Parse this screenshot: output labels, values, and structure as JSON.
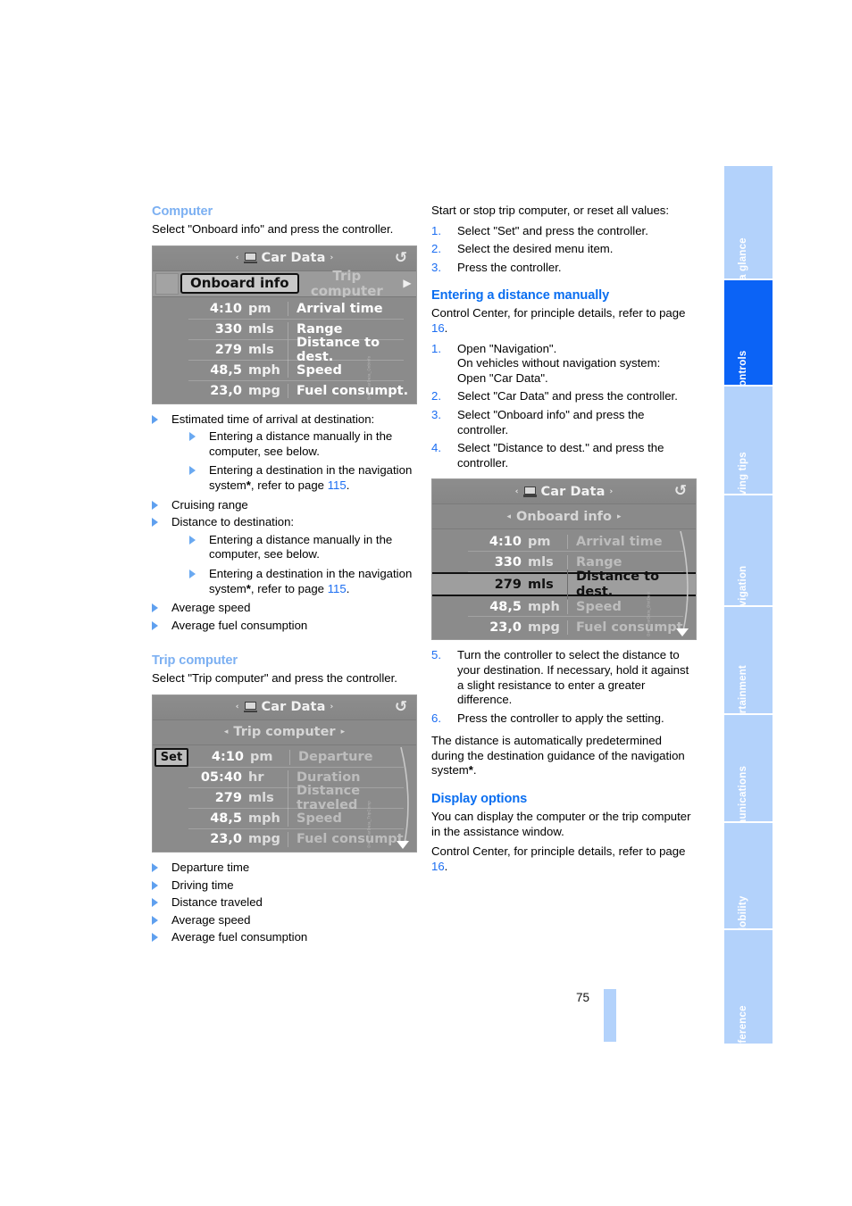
{
  "page": {
    "number": "75"
  },
  "sidebar": {
    "tabs": [
      {
        "label": "At a glance",
        "active": false
      },
      {
        "label": "Controls",
        "active": true
      },
      {
        "label": "Driving tips",
        "active": false
      },
      {
        "label": "Navigation",
        "active": false
      },
      {
        "label": "Entertainment",
        "active": false
      },
      {
        "label": "Communications",
        "active": false
      },
      {
        "label": "Mobility",
        "active": false
      },
      {
        "label": "Reference",
        "active": false
      }
    ]
  },
  "left_column": {
    "computer": {
      "heading": "Computer",
      "intro": "Select \"Onboard info\" and press the controller.",
      "screenshot": {
        "title": "Car Data",
        "left_arrow": "‹",
        "right_arrow": "›",
        "tab_selected": "Onboard info",
        "tab_unselected": "Trip computer",
        "tab_next_arrow": "▶",
        "rows": [
          {
            "value": "4:10",
            "unit": "pm",
            "label": "Arrival time"
          },
          {
            "value": "330",
            "unit": "mls",
            "label": "Range"
          },
          {
            "value": "279",
            "unit": "mls",
            "label": "Distance to dest."
          },
          {
            "value": "48,5",
            "unit": "mph",
            "label": "Speed"
          },
          {
            "value": "23,0",
            "unit": "mpg",
            "label": "Fuel consumpt."
          }
        ]
      },
      "bullets": [
        {
          "text": "Estimated time of arrival at destination:",
          "sub": [
            "Entering a distance manually in the computer, see below.",
            "Entering a destination in the navigation system*, refer to page 115."
          ]
        },
        {
          "text": "Cruising range",
          "sub": []
        },
        {
          "text": "Distance to destination:",
          "sub": [
            "Entering a distance manually in the computer, see below.",
            "Entering a destination in the navigation system*, refer to page 115."
          ]
        },
        {
          "text": "Average speed",
          "sub": []
        },
        {
          "text": "Average fuel consumption",
          "sub": []
        }
      ],
      "page_ref": "115"
    },
    "trip_computer": {
      "heading": "Trip computer",
      "intro": "Select \"Trip computer\" and press the controller.",
      "screenshot": {
        "title": "Car Data",
        "submenu": "Trip computer",
        "set_button": "Set",
        "rows": [
          {
            "value": "4:10",
            "unit": "pm",
            "label": "Departure"
          },
          {
            "value": "05:40",
            "unit": "hr",
            "label": "Duration"
          },
          {
            "value": "279",
            "unit": "mls",
            "label": "Distance traveled"
          },
          {
            "value": "48,5",
            "unit": "mph",
            "label": "Speed"
          },
          {
            "value": "23,0",
            "unit": "mpg",
            "label": "Fuel consumpt."
          }
        ]
      },
      "bullets": [
        "Departure time",
        "Driving time",
        "Distance traveled",
        "Average speed",
        "Average fuel consumption"
      ]
    }
  },
  "right_column": {
    "start_stop": {
      "intro": "Start or stop trip computer, or reset all values:",
      "steps": [
        "Select \"Set\" and press the controller.",
        "Select the desired menu item.",
        "Press the controller."
      ]
    },
    "entering_distance": {
      "heading": "Entering a distance manually",
      "intro_before": "Control Center, for principle details, refer to page ",
      "intro_ref": "16",
      "intro_after": ".",
      "steps": [
        "Open \"Navigation\".\nOn vehicles without navigation system:\nOpen \"Car Data\".",
        "Select \"Car Data\" and press the controller.",
        "Select \"Onboard info\" and press the controller.",
        "Select \"Distance to dest.\" and press the controller."
      ],
      "screenshot": {
        "title": "Car Data",
        "submenu": "Onboard info",
        "rows": [
          {
            "value": "4:10",
            "unit": "pm",
            "label": "Arrival time",
            "highlight": false
          },
          {
            "value": "330",
            "unit": "mls",
            "label": "Range",
            "highlight": false
          },
          {
            "value": "279",
            "unit": "mls",
            "label": "Distance to dest.",
            "highlight": true
          },
          {
            "value": "48,5",
            "unit": "mph",
            "label": "Speed",
            "highlight": false
          },
          {
            "value": "23,0",
            "unit": "mpg",
            "label": "Fuel consumpt.",
            "highlight": false
          }
        ]
      },
      "steps_after": [
        {
          "num": "5.",
          "text": "Turn the controller to select the distance to your destination. If necessary, hold it against a slight resistance to enter a greater difference."
        },
        {
          "num": "6.",
          "text": "Press the controller to apply the setting."
        }
      ],
      "note": "The distance is automatically predetermined during the destination guidance of the navigation system*."
    },
    "display_options": {
      "heading": "Display options",
      "body": "You can display the computer or the trip computer in the assistance window.",
      "control_center_before": "Control Center, for principle details, refer to page ",
      "control_center_ref": "16",
      "control_center_after": "."
    }
  }
}
